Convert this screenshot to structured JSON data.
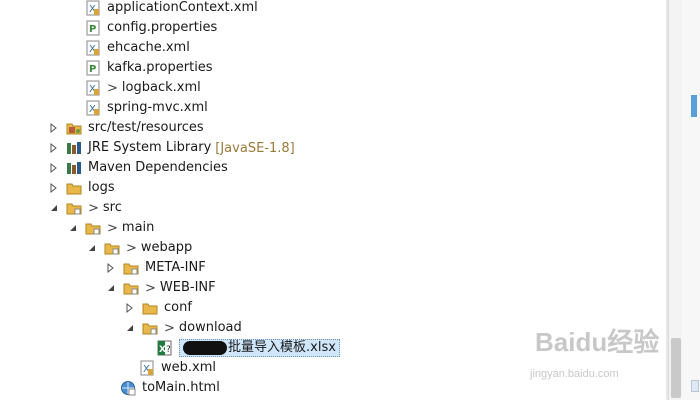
{
  "tree": {
    "items": [
      {
        "label": "applicationContext.xml",
        "dirty": "",
        "decor": "",
        "icon": "xml-file-icon",
        "arrow": ""
      },
      {
        "label": "config.properties",
        "dirty": "",
        "decor": "",
        "icon": "properties-file-icon",
        "arrow": ""
      },
      {
        "label": "ehcache.xml",
        "dirty": "",
        "decor": "",
        "icon": "xml-file-icon",
        "arrow": ""
      },
      {
        "label": "kafka.properties",
        "dirty": "",
        "decor": "",
        "icon": "properties-file-icon",
        "arrow": ""
      },
      {
        "label": "logback.xml",
        "dirty": ">",
        "decor": "",
        "icon": "xml-file-icon",
        "arrow": ""
      },
      {
        "label": "spring-mvc.xml",
        "dirty": "",
        "decor": "",
        "icon": "xml-file-icon",
        "arrow": ""
      },
      {
        "label": "src/test/resources",
        "dirty": "",
        "decor": "",
        "icon": "source-folder-icon",
        "arrow": "collapsed"
      },
      {
        "label": "JRE System Library",
        "dirty": "",
        "decor": "[JavaSE-1.8]",
        "icon": "library-icon",
        "arrow": "collapsed"
      },
      {
        "label": "Maven Dependencies",
        "dirty": "",
        "decor": "",
        "icon": "library-icon",
        "arrow": "collapsed"
      },
      {
        "label": "logs",
        "dirty": "",
        "decor": "",
        "icon": "folder-icon",
        "arrow": "collapsed"
      },
      {
        "label": "src",
        "dirty": ">",
        "decor": "",
        "icon": "folder-icon",
        "arrow": "expanded"
      },
      {
        "label": "main",
        "dirty": ">",
        "decor": "",
        "icon": "folder-icon",
        "arrow": "expanded"
      },
      {
        "label": "webapp",
        "dirty": ">",
        "decor": "",
        "icon": "folder-icon",
        "arrow": "expanded"
      },
      {
        "label": "META-INF",
        "dirty": "",
        "decor": "",
        "icon": "folder-icon",
        "arrow": "collapsed"
      },
      {
        "label": "WEB-INF",
        "dirty": ">",
        "decor": "",
        "icon": "folder-icon",
        "arrow": "expanded"
      },
      {
        "label": "conf",
        "dirty": "",
        "decor": "",
        "icon": "folder-icon",
        "arrow": "collapsed"
      },
      {
        "label": "download",
        "dirty": ">",
        "decor": "",
        "icon": "folder-icon",
        "arrow": "expanded"
      },
      {
        "label": "批量导入模板.xlsx",
        "dirty": "",
        "decor": "",
        "icon": "excel-file-icon",
        "arrow": ""
      },
      {
        "label": "web.xml",
        "dirty": "",
        "decor": "",
        "icon": "xml-file-icon",
        "arrow": ""
      },
      {
        "label": "toMain.html",
        "dirty": "",
        "decor": "",
        "icon": "html-file-icon",
        "arrow": ""
      }
    ]
  },
  "colors": {
    "selection": "#cfe6fb",
    "folder": "#e8b84a",
    "decoration": "#9a7a3a"
  },
  "watermark": {
    "brand": "Baidu经验",
    "url": "jingyan.baidu.com"
  }
}
